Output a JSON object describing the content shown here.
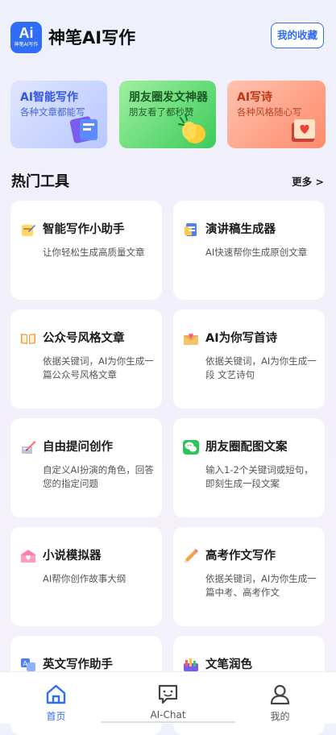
{
  "header": {
    "logo_big": "Ai",
    "logo_small": "神笔AI写作",
    "title": "神笔AI写作",
    "favorites_label": "我的收藏"
  },
  "banners": [
    {
      "title": "AI智能写作",
      "subtitle": "各种文章都能写",
      "icon": "notebook-icon"
    },
    {
      "title": "朋友圈发文神器",
      "subtitle": "朋友看了都秒赞",
      "icon": "clapping-hands-icon"
    },
    {
      "title": "AI写诗",
      "subtitle": "各种风格随心写",
      "icon": "poem-book-icon"
    }
  ],
  "section": {
    "title": "热门工具",
    "more": "更多 >"
  },
  "tools": [
    {
      "title": "智能写作小助手",
      "desc": "让你轻松生成高质量文章",
      "icon": "pencil-note-icon"
    },
    {
      "title": "演讲稿生成器",
      "desc": "AI快速帮你生成原创文章",
      "icon": "document-icon"
    },
    {
      "title": "公众号风格文章",
      "desc": "依据关键词，AI为你生成一篇公众号风格文章",
      "icon": "open-book-icon"
    },
    {
      "title": "AI为你写首诗",
      "desc": "依据关键词，AI为你生成一段 文艺诗句",
      "icon": "love-letter-icon"
    },
    {
      "title": "自由提问创作",
      "desc": "自定义AI扮演的角色，回答您的指定问题",
      "icon": "writing-desk-icon"
    },
    {
      "title": "朋友圈配图文案",
      "desc": "输入1-2个关键词或短句，即刻生成一段文案",
      "icon": "wechat-icon"
    },
    {
      "title": "小说模拟器",
      "desc": "AI帮你创作故事大纲",
      "icon": "mailbox-heart-icon"
    },
    {
      "title": "高考作文写作",
      "desc": "依据关键词，AI为你生成一篇中考、高考作文",
      "icon": "pencil-icon"
    },
    {
      "title": "英文写作助手",
      "desc": "",
      "icon": "translate-icon"
    },
    {
      "title": "文笔润色",
      "desc": "",
      "icon": "paint-palette-icon"
    }
  ],
  "tabbar": [
    {
      "label": "首页",
      "icon": "home-icon",
      "active": true
    },
    {
      "label": "AI-Chat",
      "icon": "chat-icon",
      "active": false
    },
    {
      "label": "我的",
      "icon": "profile-icon",
      "active": false
    }
  ],
  "colors": {
    "accent": "#2f6df6",
    "background": "#f1effb"
  }
}
